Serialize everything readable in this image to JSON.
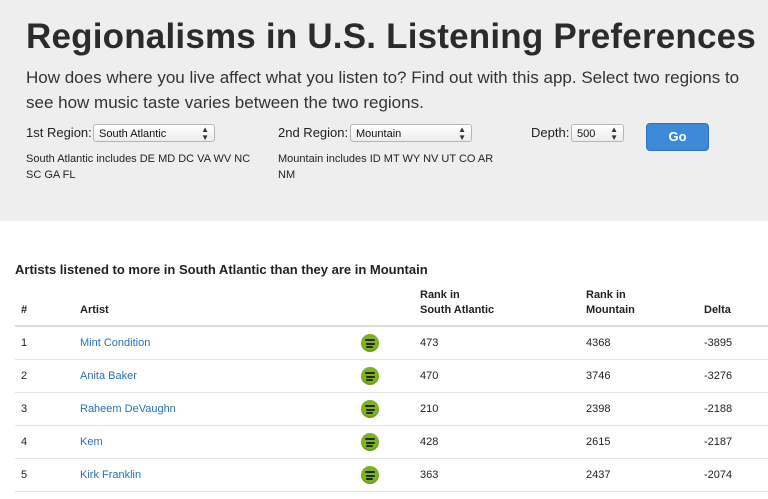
{
  "header": {
    "title": "Regionalisms in U.S. Listening Preferences",
    "intro": "How does where you live affect what you listen to? Find out with this app. Select two regions to see how music taste varies between the two regions."
  },
  "controls": {
    "region1_label": "1st Region:",
    "region1_value": "South Atlantic",
    "region2_label": "2nd Region:",
    "region2_value": "Mountain",
    "depth_label": "Depth:",
    "depth_value": "500",
    "go_label": "Go",
    "region1_note": "South Atlantic includes DE MD DC VA WV NC SC GA FL",
    "region2_note": "Mountain includes ID MT WY NV UT CO AR NM"
  },
  "results": {
    "title": "Artists listened to more in South Atlantic than they are in Mountain",
    "columns": {
      "num": "#",
      "artist": "Artist",
      "rank1_line1": "Rank in",
      "rank1_line2": "South Atlantic",
      "rank2_line1": "Rank in",
      "rank2_line2": "Mountain",
      "delta": "Delta"
    },
    "rows": [
      {
        "num": "1",
        "artist": "Mint Condition",
        "rank1": "473",
        "rank2": "4368",
        "delta": "-3895"
      },
      {
        "num": "2",
        "artist": "Anita Baker",
        "rank1": "470",
        "rank2": "3746",
        "delta": "-3276"
      },
      {
        "num": "3",
        "artist": "Raheem DeVaughn",
        "rank1": "210",
        "rank2": "2398",
        "delta": "-2188"
      },
      {
        "num": "4",
        "artist": "Kem",
        "rank1": "428",
        "rank2": "2615",
        "delta": "-2187"
      },
      {
        "num": "5",
        "artist": "Kirk Franklin",
        "rank1": "363",
        "rank2": "2437",
        "delta": "-2074"
      }
    ],
    "play_icon": "spotify-icon",
    "accent_color": "#3f8ad8",
    "spotify_color": "#7fb21f"
  }
}
